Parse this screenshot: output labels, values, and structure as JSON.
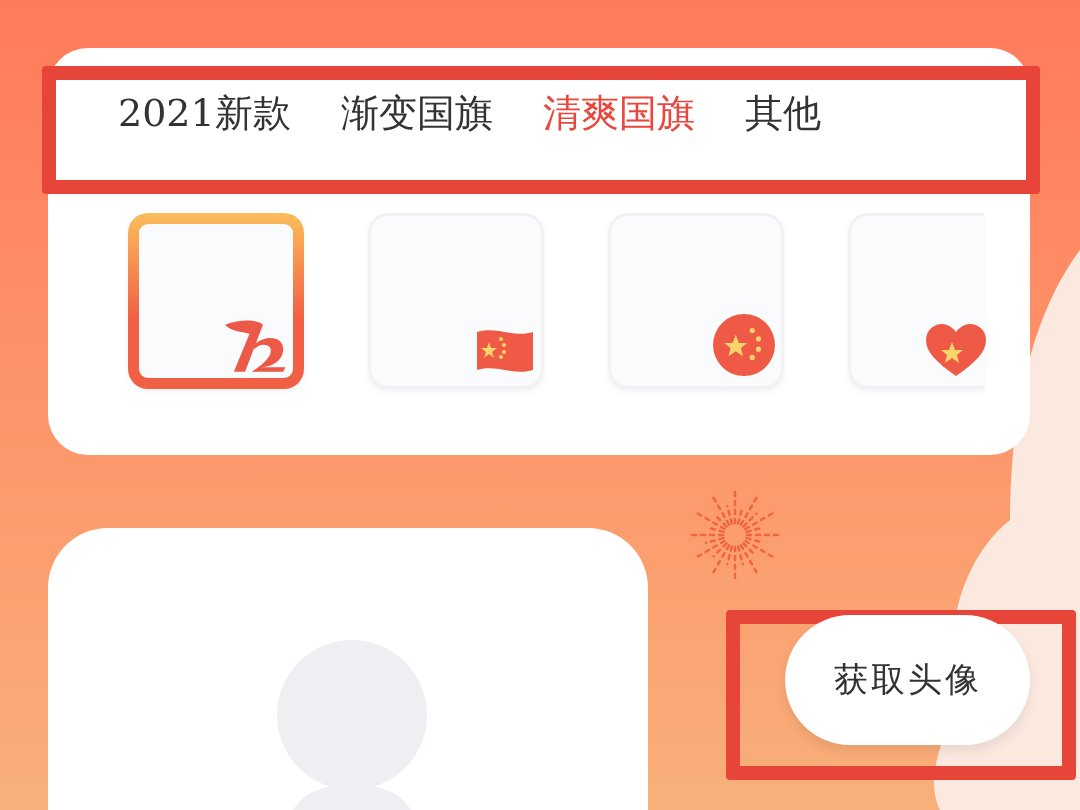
{
  "tabs": [
    {
      "label": "2021新款",
      "selected": false
    },
    {
      "label": "渐变国旗",
      "selected": false
    },
    {
      "label": "清爽国旗",
      "selected": true
    },
    {
      "label": "其他",
      "selected": false
    }
  ],
  "frames": [
    {
      "kind": "logo",
      "selected": true
    },
    {
      "kind": "flag",
      "selected": false
    },
    {
      "kind": "circle",
      "selected": false
    },
    {
      "kind": "heart",
      "selected": false
    }
  ],
  "get_avatar_button": {
    "label": "获取头像"
  },
  "highlights": {
    "tabs": true,
    "button": true
  }
}
